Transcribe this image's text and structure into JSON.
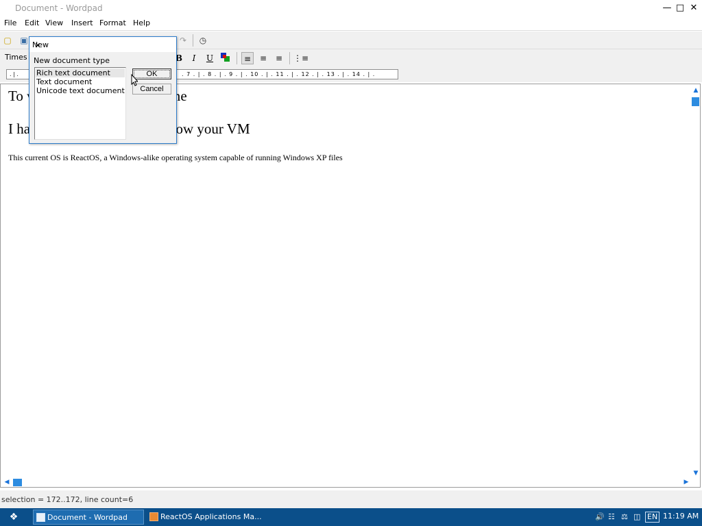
{
  "window": {
    "title": "Document - Wordpad",
    "minimize_icon": "minimize-icon",
    "maximize_icon": "maximize-icon",
    "close_icon": "close-icon"
  },
  "menu": [
    "File",
    "Edit",
    "View",
    "Insert",
    "Format",
    "Help"
  ],
  "toolbar": {
    "font_name": "Times N",
    "bold": "B",
    "italic": "I",
    "underline": "U"
  },
  "ruler": {
    "marks": ". 7 . | . 8 . | . 9 . | . 10 . | . 11 . | . 12 . | . 13 . | . 14 . | ."
  },
  "document": {
    "line1": "To w",
    "line1_tail": "me",
    "line2": "I ha",
    "line2_tail": "now your VM",
    "paragraph": "This current OS is ReactOS, a Windows-alike operating system capable of running Windows XP files"
  },
  "status": {
    "text": "selection = 172..172, line count=6"
  },
  "dialog": {
    "title": "New",
    "label": "New document type",
    "options": [
      "Rich text document",
      "Text document",
      "Unicode text document"
    ],
    "selected_index": 0,
    "ok_label": "OK",
    "cancel_label": "Cancel"
  },
  "taskbar": {
    "tasks": [
      "Document - Wordpad",
      "ReactOS Applications Ma..."
    ],
    "language": "EN",
    "clock": "11:19 AM"
  },
  "colors": {
    "accent": "#2d8ce0",
    "taskbar": "#0b4f8a",
    "dialog_border": "#2c7ccb"
  }
}
